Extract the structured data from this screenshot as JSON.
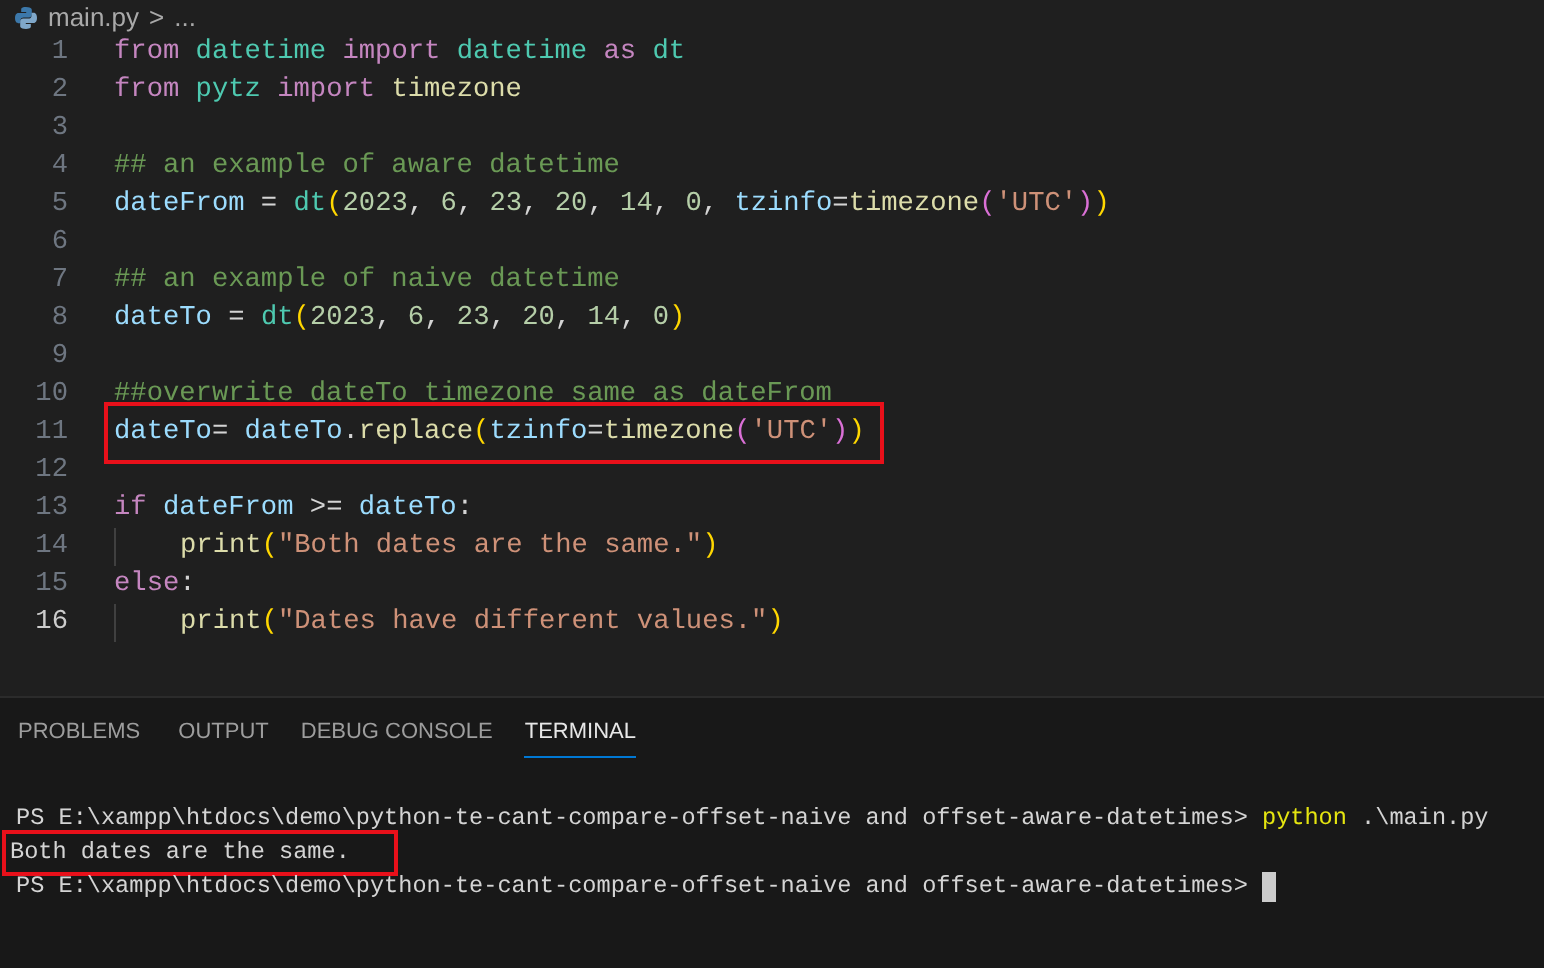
{
  "breadcrumb": {
    "file": "main.py",
    "separator": ">",
    "more": "..."
  },
  "editor": {
    "lines": [
      {
        "num": "1",
        "tokens": [
          {
            "t": "from ",
            "kind": "keyword"
          },
          {
            "t": "datetime ",
            "kind": "module"
          },
          {
            "t": "import ",
            "kind": "keyword"
          },
          {
            "t": "datetime ",
            "kind": "module"
          },
          {
            "t": "as ",
            "kind": "keyword"
          },
          {
            "t": "dt",
            "kind": "module"
          }
        ]
      },
      {
        "num": "2",
        "tokens": [
          {
            "t": "from ",
            "kind": "keyword"
          },
          {
            "t": "pytz ",
            "kind": "module"
          },
          {
            "t": "import ",
            "kind": "keyword"
          },
          {
            "t": "timezone",
            "kind": "func"
          }
        ]
      },
      {
        "num": "3"
      },
      {
        "num": "4",
        "tokens": [
          {
            "t": "## an example of aware datetime",
            "kind": "comment"
          }
        ]
      },
      {
        "num": "5",
        "tokens": [
          {
            "t": "dateFrom",
            "kind": "var"
          },
          {
            "t": " = ",
            "kind": "plain"
          },
          {
            "t": "dt",
            "kind": "module"
          },
          {
            "t": "(",
            "kind": "bracket1"
          },
          {
            "t": "2023",
            "kind": "number"
          },
          {
            "t": ", ",
            "kind": "plain"
          },
          {
            "t": "6",
            "kind": "number"
          },
          {
            "t": ", ",
            "kind": "plain"
          },
          {
            "t": "23",
            "kind": "number"
          },
          {
            "t": ", ",
            "kind": "plain"
          },
          {
            "t": "20",
            "kind": "number"
          },
          {
            "t": ", ",
            "kind": "plain"
          },
          {
            "t": "14",
            "kind": "number"
          },
          {
            "t": ", ",
            "kind": "plain"
          },
          {
            "t": "0",
            "kind": "number"
          },
          {
            "t": ", ",
            "kind": "plain"
          },
          {
            "t": "tzinfo",
            "kind": "var"
          },
          {
            "t": "=",
            "kind": "plain"
          },
          {
            "t": "timezone",
            "kind": "func"
          },
          {
            "t": "(",
            "kind": "bracket2"
          },
          {
            "t": "'UTC'",
            "kind": "string"
          },
          {
            "t": ")",
            "kind": "bracket2"
          },
          {
            "t": ")",
            "kind": "bracket1"
          }
        ]
      },
      {
        "num": "6"
      },
      {
        "num": "7",
        "tokens": [
          {
            "t": "## an example of naive datetime",
            "kind": "comment"
          }
        ]
      },
      {
        "num": "8",
        "tokens": [
          {
            "t": "dateTo",
            "kind": "var"
          },
          {
            "t": " = ",
            "kind": "plain"
          },
          {
            "t": "dt",
            "kind": "module"
          },
          {
            "t": "(",
            "kind": "bracket1"
          },
          {
            "t": "2023",
            "kind": "number"
          },
          {
            "t": ", ",
            "kind": "plain"
          },
          {
            "t": "6",
            "kind": "number"
          },
          {
            "t": ", ",
            "kind": "plain"
          },
          {
            "t": "23",
            "kind": "number"
          },
          {
            "t": ", ",
            "kind": "plain"
          },
          {
            "t": "20",
            "kind": "number"
          },
          {
            "t": ", ",
            "kind": "plain"
          },
          {
            "t": "14",
            "kind": "number"
          },
          {
            "t": ", ",
            "kind": "plain"
          },
          {
            "t": "0",
            "kind": "number"
          },
          {
            "t": ")",
            "kind": "bracket1"
          }
        ]
      },
      {
        "num": "9"
      },
      {
        "num": "10",
        "tokens": [
          {
            "t": "##overwrite dateTo timezone same as dateFrom",
            "kind": "comment"
          }
        ]
      },
      {
        "num": "11",
        "boxed": true,
        "tokens": [
          {
            "t": "dateTo",
            "kind": "var"
          },
          {
            "t": "= ",
            "kind": "plain"
          },
          {
            "t": "dateTo",
            "kind": "var"
          },
          {
            "t": ".",
            "kind": "plain"
          },
          {
            "t": "replace",
            "kind": "func"
          },
          {
            "t": "(",
            "kind": "bracket1"
          },
          {
            "t": "tzinfo",
            "kind": "var"
          },
          {
            "t": "=",
            "kind": "plain"
          },
          {
            "t": "timezone",
            "kind": "func"
          },
          {
            "t": "(",
            "kind": "bracket2"
          },
          {
            "t": "'UTC'",
            "kind": "string"
          },
          {
            "t": ")",
            "kind": "bracket2"
          },
          {
            "t": ")",
            "kind": "bracket1"
          }
        ]
      },
      {
        "num": "12"
      },
      {
        "num": "13",
        "tokens": [
          {
            "t": "if ",
            "kind": "keyword"
          },
          {
            "t": "dateFrom",
            "kind": "var"
          },
          {
            "t": " >= ",
            "kind": "plain"
          },
          {
            "t": "dateTo",
            "kind": "var"
          },
          {
            "t": ":",
            "kind": "plain"
          }
        ]
      },
      {
        "num": "14",
        "guide": true,
        "tokens": [
          {
            "t": "print",
            "kind": "func"
          },
          {
            "t": "(",
            "kind": "bracket1"
          },
          {
            "t": "\"Both dates are the same.\"",
            "kind": "string"
          },
          {
            "t": ")",
            "kind": "bracket1"
          }
        ]
      },
      {
        "num": "15",
        "tokens": [
          {
            "t": "else",
            "kind": "keyword"
          },
          {
            "t": ":",
            "kind": "plain"
          }
        ]
      },
      {
        "num": "16",
        "active": true,
        "guide": true,
        "tokens": [
          {
            "t": "print",
            "kind": "func"
          },
          {
            "t": "(",
            "kind": "bracket1"
          },
          {
            "t": "\"Dates have different values.\"",
            "kind": "string"
          },
          {
            "t": ")",
            "kind": "bracket1"
          }
        ]
      }
    ]
  },
  "panel": {
    "tabs": [
      {
        "label": "PROBLEMS",
        "selected": false
      },
      {
        "label": "OUTPUT",
        "selected": false
      },
      {
        "label": "DEBUG CONSOLE",
        "selected": false
      },
      {
        "label": "TERMINAL",
        "selected": true
      }
    ],
    "terminal": [
      {
        "tokens": [
          {
            "t": "PS E:\\xampp\\htdocs\\demo\\python-te-cant-compare-offset-naive and offset-aware-datetimes> ",
            "kind": "plain"
          },
          {
            "t": "python",
            "kind": "command"
          },
          {
            "t": " .\\main.py",
            "kind": "plain"
          }
        ]
      },
      {
        "boxed": true,
        "tokens": [
          {
            "t": "Both dates are the same.",
            "kind": "plain"
          }
        ]
      },
      {
        "cursor": true,
        "tokens": [
          {
            "t": "PS E:\\xampp\\htdocs\\demo\\python-te-cant-compare-offset-naive and offset-aware-datetimes> ",
            "kind": "plain"
          }
        ]
      }
    ]
  }
}
